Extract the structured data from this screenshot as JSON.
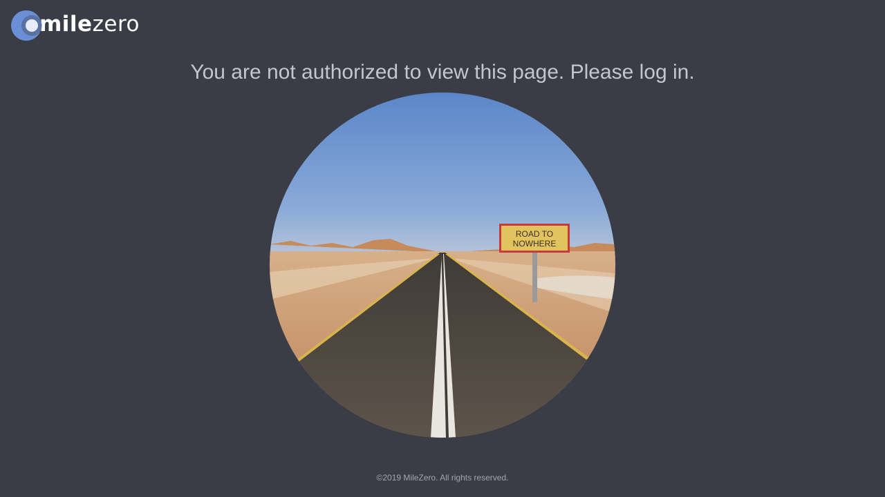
{
  "brand": {
    "logo_text_bold": "mile",
    "logo_text_light": "zero"
  },
  "message": {
    "headline": "You are not authorized to view this page. Please log in."
  },
  "hero": {
    "sign_line1": "ROAD TO",
    "sign_line2": "NOWHERE"
  },
  "footer": {
    "copyright": "©2019 MileZero. All rights reserved."
  },
  "colors": {
    "background": "#3a3d46",
    "headline": "#c3c6cd",
    "logo_ring": "#6b8fd6"
  }
}
